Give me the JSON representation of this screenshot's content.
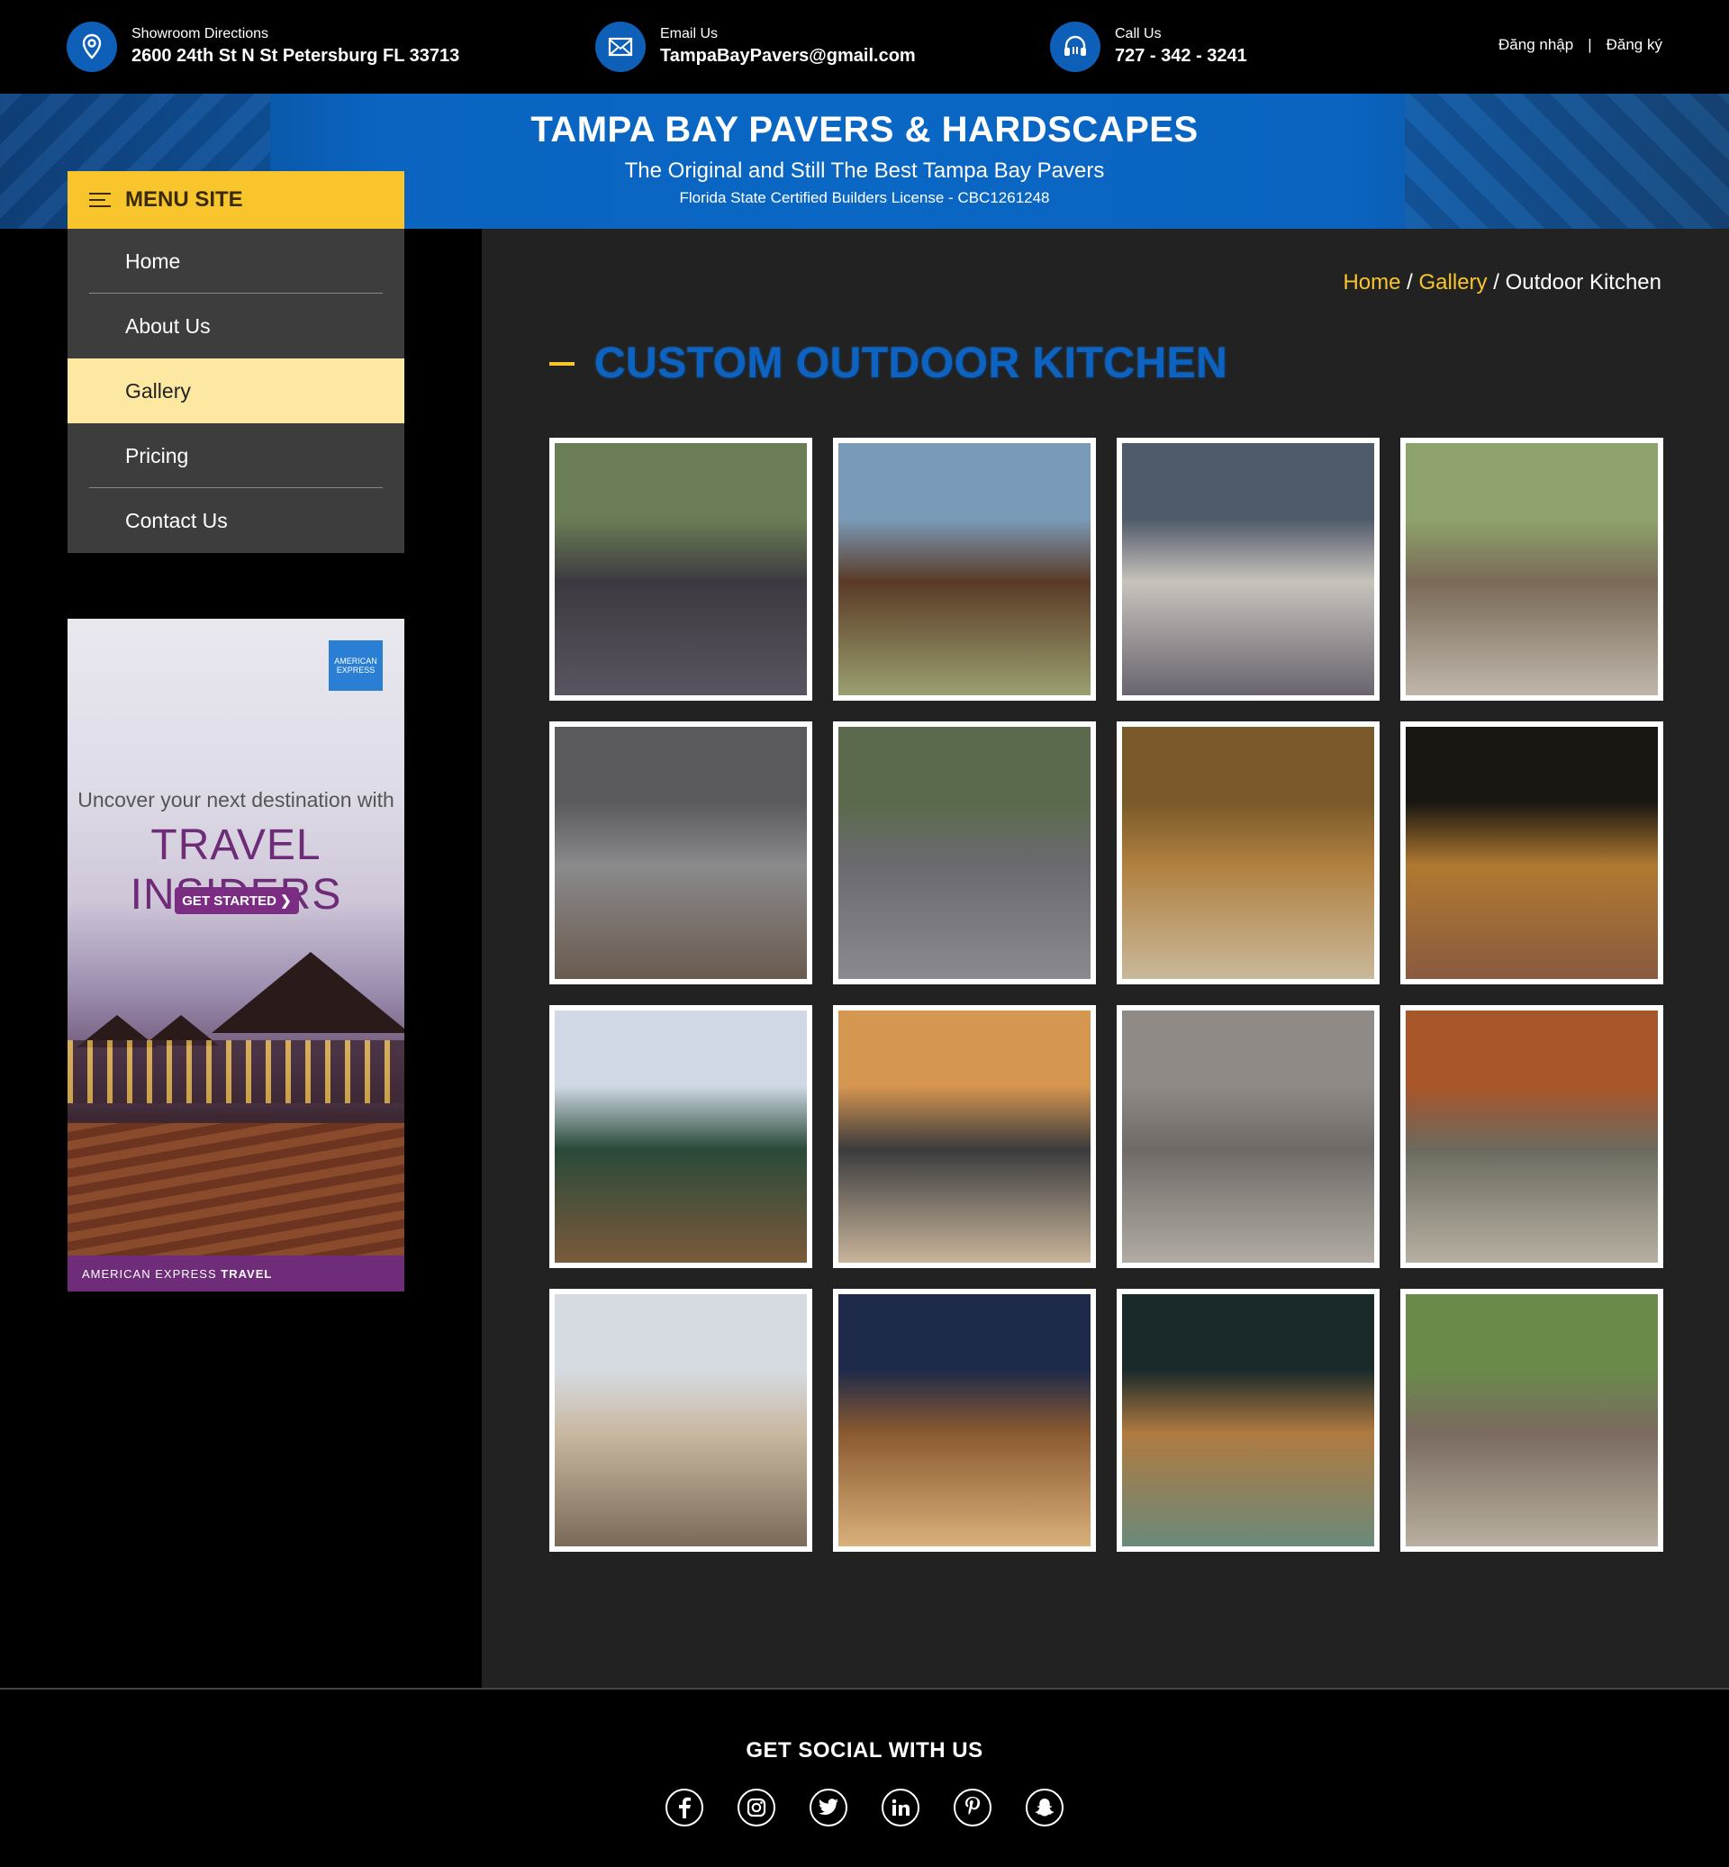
{
  "topbar": {
    "contacts": [
      {
        "label": "Showroom Directions",
        "value": "2600 24th St N St Petersburg FL 33713",
        "icon": "map-pin-icon"
      },
      {
        "label": "Email Us",
        "value": "TampaBayPavers@gmail.com",
        "icon": "envelope-icon"
      },
      {
        "label": "Call Us",
        "value": "727 - 342 - 3241",
        "icon": "headset-icon"
      }
    ],
    "login": "Đăng nhập",
    "divider": "|",
    "register": "Đăng ký"
  },
  "banner": {
    "title": "TAMPA BAY PAVERS & HARDSCAPES",
    "subtitle": "The Original and Still The Best Tampa Bay Pavers",
    "license": "Florida State Certified Builders License - CBC1261248"
  },
  "sidebar": {
    "menu_title": "MENU SITE",
    "items": [
      {
        "label": "Home"
      },
      {
        "label": "About Us"
      },
      {
        "label": "Gallery",
        "active": true
      },
      {
        "label": "Pricing"
      },
      {
        "label": "Contact Us"
      }
    ]
  },
  "ad": {
    "brand_badge": "AMERICAN EXPRESS",
    "line1": "Uncover your next destination with",
    "line2": "TRAVEL INSIDERS",
    "cta": "GET STARTED ❯",
    "footer_text": "AMERICAN EXPRESS",
    "footer_bold": "TRAVEL"
  },
  "breadcrumb": {
    "home": "Home",
    "gallery": "Gallery",
    "separator": "/",
    "current": "Outdoor Kitchen"
  },
  "page_title": "CUSTOM OUTDOOR KITCHEN",
  "gallery": {
    "count": 16,
    "image_palettes": [
      [
        "#6b7d55",
        "#3c3a40",
        "#5a5560"
      ],
      [
        "#7a9bb8",
        "#5a3a26",
        "#9aa070"
      ],
      [
        "#4f5a6a",
        "#c8c3bb",
        "#6a6470"
      ],
      [
        "#8ea36b",
        "#7a6a58",
        "#bfb6aa"
      ],
      [
        "#5b5b5e",
        "#8a8a8c",
        "#6a5b4f"
      ],
      [
        "#5b6a4c",
        "#6b6a70",
        "#8a8a90"
      ],
      [
        "#7a5a2a",
        "#b08040",
        "#c9b89a"
      ],
      [
        "#1a1612",
        "#b07a30",
        "#8a5a40"
      ],
      [
        "#cfd8e4",
        "#2a4a3a",
        "#7a5a3a"
      ],
      [
        "#d59650",
        "#3b3b3d",
        "#c8b49a"
      ],
      [
        "#8f8a86",
        "#6f6a66",
        "#b1aba4"
      ],
      [
        "#a8562a",
        "#6c6a5e",
        "#b6b0a2"
      ],
      [
        "#d6dbe2",
        "#c9b8a0",
        "#7a6a58"
      ],
      [
        "#1e2a4a",
        "#8a5a30",
        "#d9b07a"
      ],
      [
        "#1a2a2a",
        "#b07a40",
        "#6a8a7a"
      ],
      [
        "#6a8a4a",
        "#7a6a60",
        "#b8b0a0"
      ]
    ]
  },
  "footer": {
    "heading": "GET SOCIAL WITH US",
    "socials": [
      "facebook-icon",
      "instagram-icon",
      "twitter-icon",
      "linkedin-icon",
      "pinterest-icon",
      "snapchat-icon"
    ]
  },
  "colors": {
    "accent_yellow": "#f8c52c",
    "brand_blue": "#0e62c0",
    "active_menu": "#fde8a2"
  }
}
